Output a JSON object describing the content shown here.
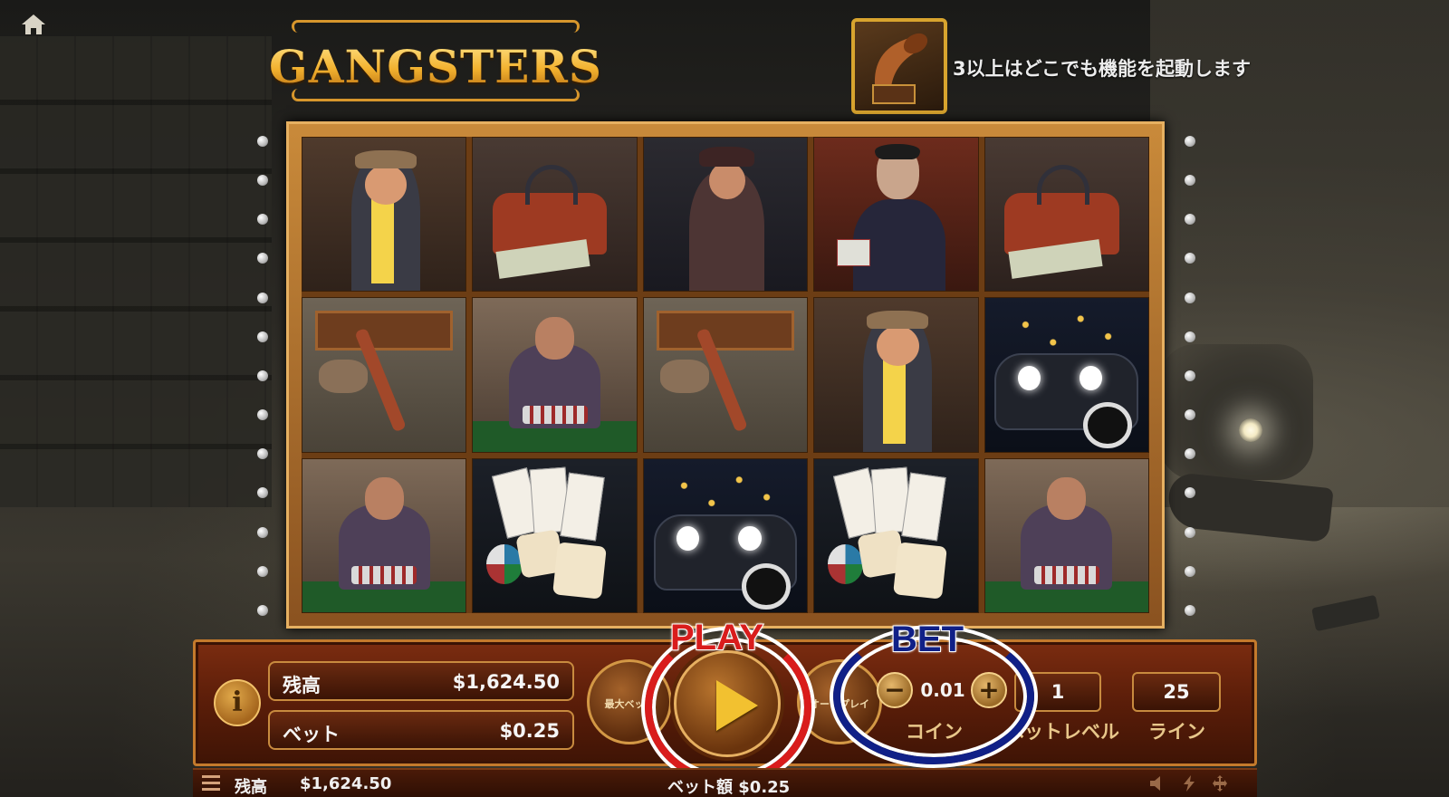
{
  "game": {
    "logo_text": "GANGSTERS",
    "feature_text": "3以上はどこでも機能を起動します",
    "feature_icon": "gramophone-icon"
  },
  "reels": [
    [
      "boss-cigar",
      "money-bag",
      "man-with-bottle",
      "man-with-cards",
      "money-bag"
    ],
    [
      "tommy-gun-case",
      "poker-player",
      "tommy-gun-case",
      "boss-cigar",
      "vintage-car"
    ],
    [
      "poker-player",
      "cards-and-dice",
      "vintage-car",
      "cards-and-dice",
      "poker-player"
    ]
  ],
  "panel": {
    "balance_label": "残高",
    "balance_value": "$1,624.50",
    "bet_label": "ベット",
    "bet_value": "$0.25",
    "info_label": "i",
    "maxbet_label": "最大ベット",
    "auto_label": "オートプレイ",
    "coin_value": "0.01",
    "coin_label": "コイン",
    "minus": "−",
    "plus": "+",
    "bet_level_value": "1",
    "bet_level_label": "ベットレベル",
    "lines_value": "25",
    "lines_label": "ライン"
  },
  "annotations": {
    "play": "PLAY",
    "bet": "BET",
    "play_color": "#d91c1c",
    "bet_color": "#102087"
  },
  "status_bar": {
    "balance_label": "残高",
    "balance_value": "$1,624.50",
    "bet_text": "ベット額 $0.25"
  },
  "icons": {
    "home": "home-icon",
    "menu": "menu-icon",
    "sound": "speaker-icon",
    "turbo": "lightning-icon",
    "fullscreen": "fullscreen-icon"
  }
}
